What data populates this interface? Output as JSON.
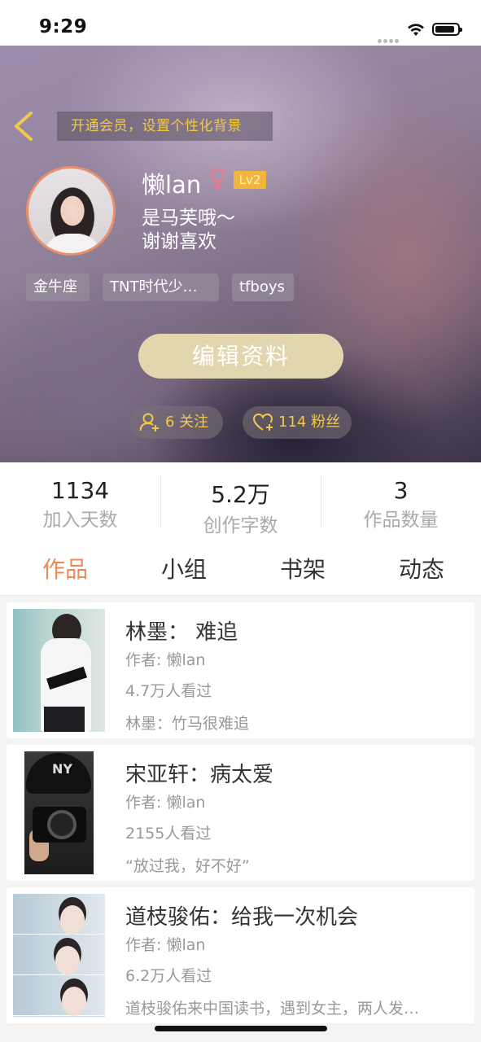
{
  "status_bar": {
    "time": "9:29"
  },
  "header": {
    "vip_banner": "开通会员，设置个性化背景",
    "username": "懒lan",
    "gender_symbol": "♀",
    "level": "Lv2",
    "bio_line1": "是马芙哦～",
    "bio_line2": "谢谢喜欢",
    "tags": [
      "金牛座",
      "TNT时代少…",
      "tfboys"
    ],
    "edit_button": "编辑资料",
    "following": "6 关注",
    "fans": "114 粉丝",
    "accent_color": "#f2c94c",
    "gender_color": "#e87a92"
  },
  "stats": [
    {
      "value": "1134",
      "label": "加入天数"
    },
    {
      "value": "5.2万",
      "label": "创作字数"
    },
    {
      "value": "3",
      "label": "作品数量"
    }
  ],
  "tabs": [
    {
      "label": "作品",
      "active": true
    },
    {
      "label": "小组",
      "active": false
    },
    {
      "label": "书架",
      "active": false
    },
    {
      "label": "动态",
      "active": false
    }
  ],
  "tab_active_color": "#ee8a55",
  "works": [
    {
      "title": "林墨：  难追",
      "author": "作者: 懒lan",
      "views": "4.7万人看过",
      "desc": "林墨：竹马很难追"
    },
    {
      "title": "宋亚轩：病太爱",
      "author": "作者: 懒lan",
      "views": "2155人看过",
      "desc": "“放过我，好不好”"
    },
    {
      "title": "道枝骏佑：给我一次机会",
      "author": "作者: 懒lan",
      "views": "6.2万人看过",
      "desc": "道枝骏佑来中国读书，遇到女主，两人发…"
    }
  ]
}
